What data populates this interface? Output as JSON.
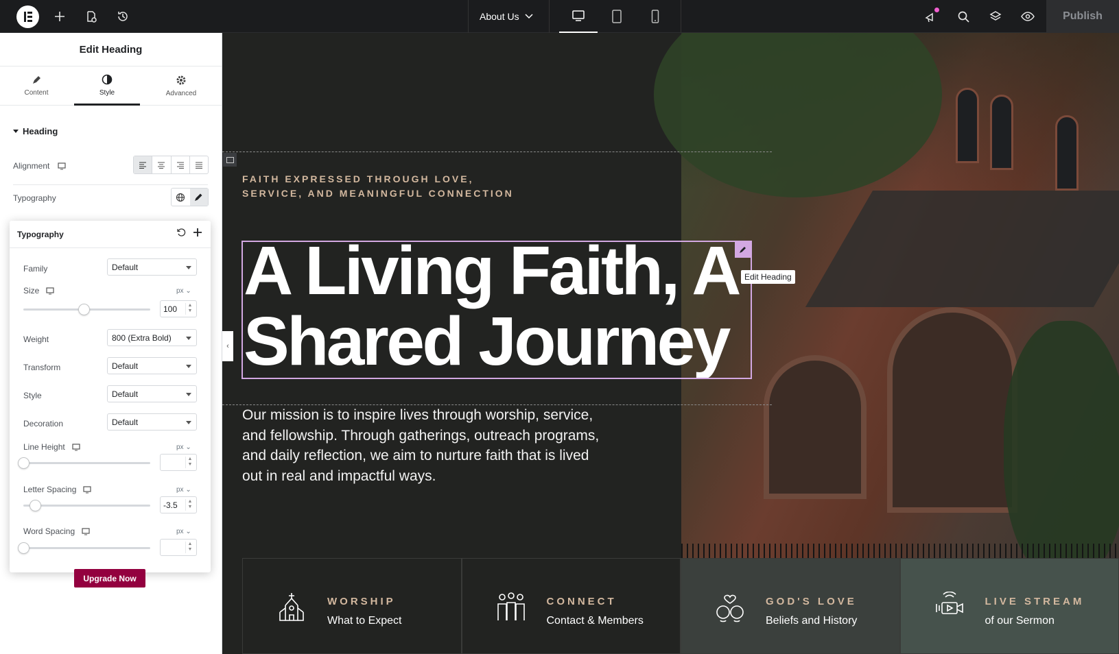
{
  "topbar": {
    "page_selector": "About Us",
    "publish_label": "Publish"
  },
  "panel": {
    "title": "Edit Heading",
    "tabs": [
      {
        "label": "Content"
      },
      {
        "label": "Style"
      },
      {
        "label": "Advanced"
      }
    ],
    "section": "Heading",
    "alignment_label": "Alignment",
    "typography_label": "Typography",
    "popover": {
      "title": "Typography",
      "family_label": "Family",
      "family_value": "Default",
      "size_label": "Size",
      "size_unit": "px",
      "size_value": "100",
      "weight_label": "Weight",
      "weight_value": "800 (Extra Bold)",
      "transform_label": "Transform",
      "transform_value": "Default",
      "style_label": "Style",
      "style_value": "Default",
      "decoration_label": "Decoration",
      "decoration_value": "Default",
      "line_height_label": "Line Height",
      "line_height_unit": "px",
      "letter_spacing_label": "Letter Spacing",
      "letter_spacing_unit": "px",
      "letter_spacing_value": "-3.5",
      "word_spacing_label": "Word Spacing",
      "word_spacing_unit": "px"
    },
    "upgrade_label": "Upgrade Now"
  },
  "canvas": {
    "eyebrow": "FAITH EXPRESSED THROUGH LOVE, SERVICE, AND MEANINGFUL CONNECTION",
    "heading": "A Living Faith, A Shared Journey",
    "tooltip": "Edit Heading",
    "mission": "Our mission is to inspire lives through worship, service, and fellowship. Through gatherings, outreach programs, and daily reflection, we aim to nurture faith that is lived out in real and impactful ways.",
    "cards": [
      {
        "title": "WORSHIP",
        "sub": "What to Expect",
        "icon": "church-icon"
      },
      {
        "title": "CONNECT",
        "sub": "Contact & Members",
        "icon": "people-icon"
      },
      {
        "title": "GOD'S LOVE",
        "sub": "Beliefs and History",
        "icon": "couple-heart-icon"
      },
      {
        "title": "LIVE STREAM",
        "sub": "of our Sermon",
        "icon": "video-stream-icon"
      }
    ]
  },
  "colors": {
    "accent": "#93003f",
    "selection": "#d3a8e2",
    "eyebrow": "#d3b89f",
    "canvas_bg": "#222321"
  }
}
